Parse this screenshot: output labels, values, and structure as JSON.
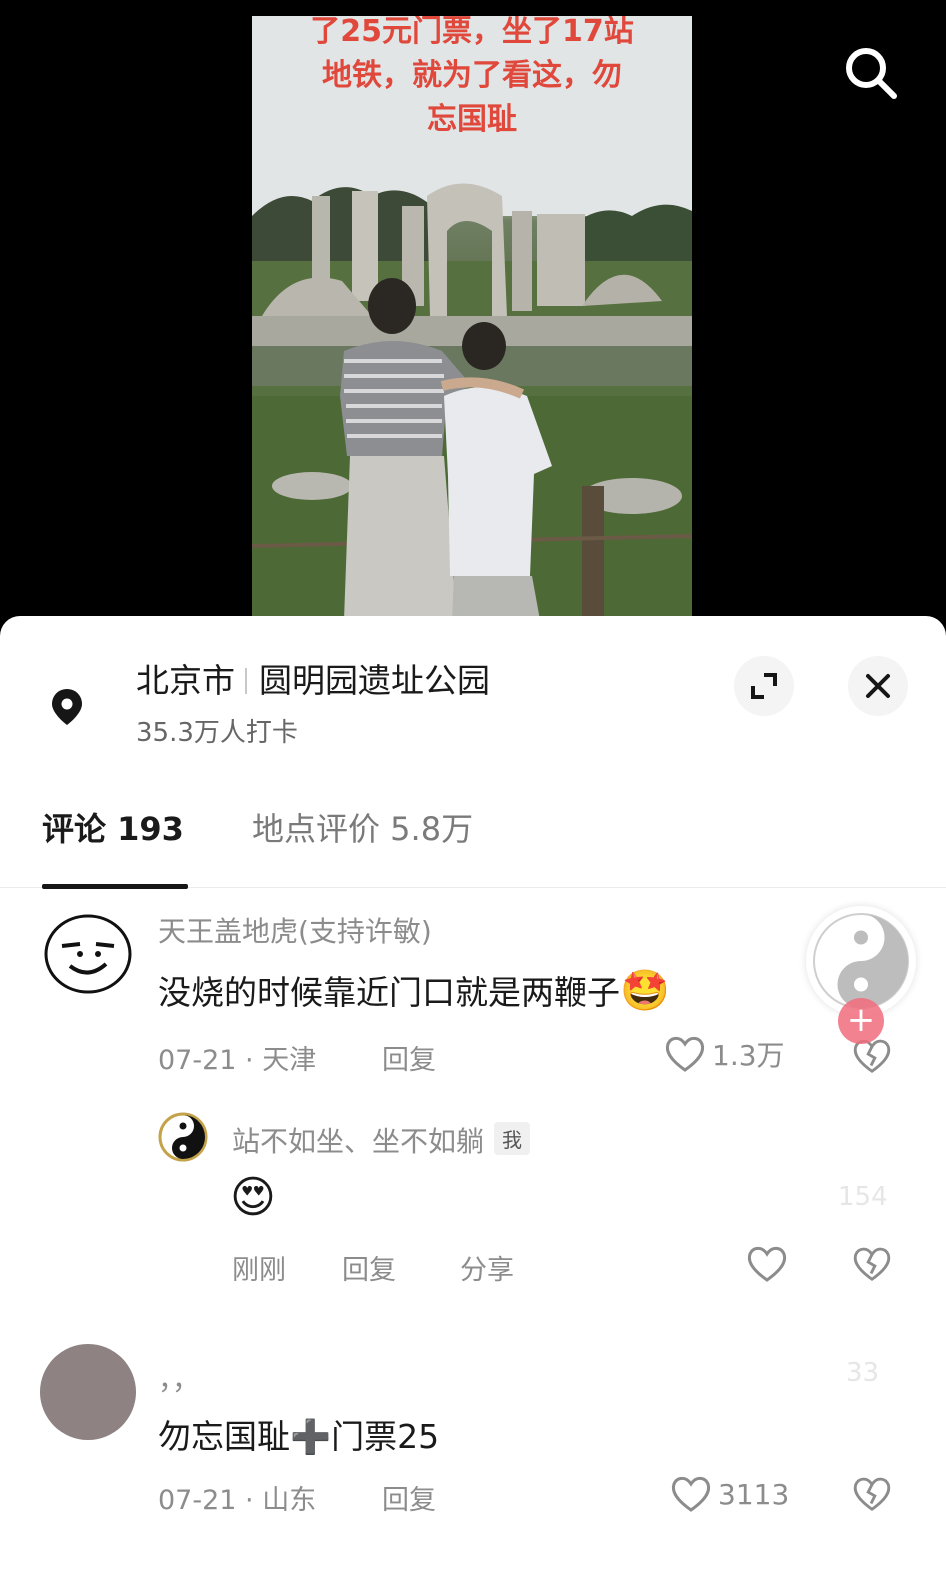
{
  "video": {
    "caption_lines": [
      "了25元门票，坐了17站",
      "地铁，就为了看这，勿",
      "忘国耻"
    ]
  },
  "location": {
    "city": "北京市",
    "place": "圆明园遗址公园",
    "checkins": "35.3万人打卡"
  },
  "tabs": [
    {
      "label": "评论 193"
    },
    {
      "label": "地点评价 5.8万"
    }
  ],
  "comments": [
    {
      "author": "天王盖地虎(支持许敏)",
      "text": "没烧的时候靠近门口就是两鞭子",
      "emoji": "🤩",
      "meta": "07-21 · 天津",
      "reply_label": "回复",
      "likes": "1.3万"
    },
    {
      "author": "站不如坐、坐不如躺",
      "badge": "我",
      "emoji": "😍",
      "meta": "刚刚",
      "reply_label": "回复",
      "share_label": "分享"
    },
    {
      "author": "，，",
      "text": "勿忘国耻➕门票25",
      "meta": "07-21 · 山东",
      "reply_label": "回复",
      "likes": "3113"
    }
  ],
  "ghost_counts": [
    "154",
    "33"
  ],
  "colors": {
    "caption": "#e0483c",
    "fab_plus": "#f26d7d"
  },
  "icons": [
    "search-icon",
    "location-pin-icon",
    "expand-icon",
    "close-icon",
    "heart-icon",
    "broken-heart-icon",
    "yin-yang-icon",
    "plus-icon"
  ]
}
